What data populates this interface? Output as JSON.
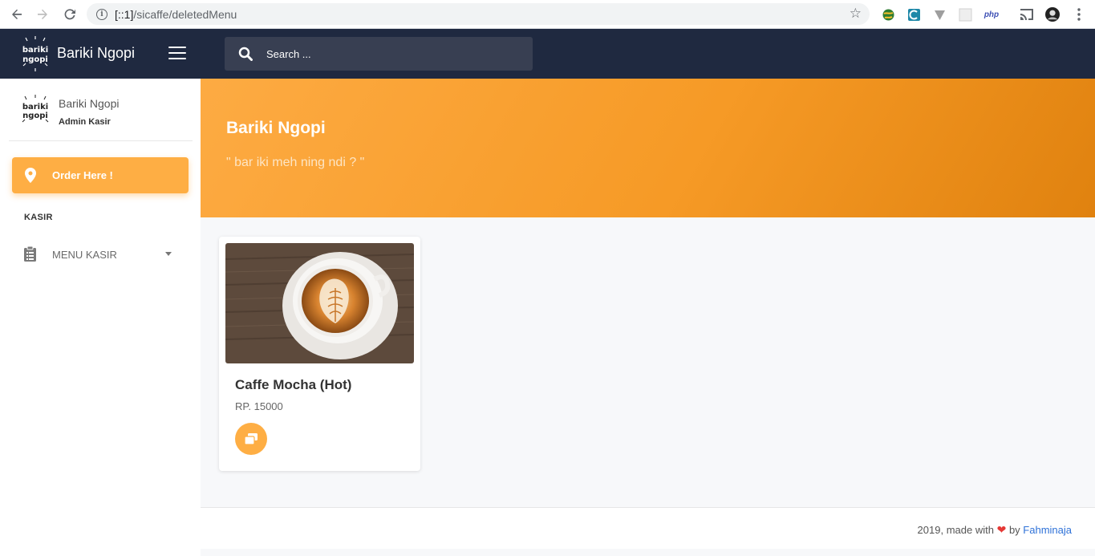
{
  "browser": {
    "url_host": "[::1]",
    "url_path": "/sicaffe/deletedMenu",
    "extensions": [
      "globe-extension-icon",
      "c-extension-icon",
      "v-extension-icon",
      "blank-extension-icon",
      "php"
    ]
  },
  "brand": {
    "name": "Bariki Ngopi",
    "logo_text_top": "bariki",
    "logo_text_bottom": "ngopi"
  },
  "user": {
    "name": "Bariki Ngopi",
    "role": "Admin Kasir"
  },
  "sidebar": {
    "order_button": "Order Here !",
    "section_title": "KASIR",
    "menu_item": "MENU KASIR"
  },
  "search": {
    "placeholder": "Search ..."
  },
  "hero": {
    "title": "Bariki Ngopi",
    "subtitle": "\" bar iki meh ning ndi ? \""
  },
  "products": [
    {
      "name": "Caffe Mocha (Hot)",
      "price": "RP. 15000"
    }
  ],
  "footer": {
    "prefix": "2019, made with",
    "by": "by",
    "author": "Fahminaja"
  },
  "colors": {
    "accent": "#feae44",
    "navbar": "#1f2940",
    "link": "#2f72d8"
  }
}
